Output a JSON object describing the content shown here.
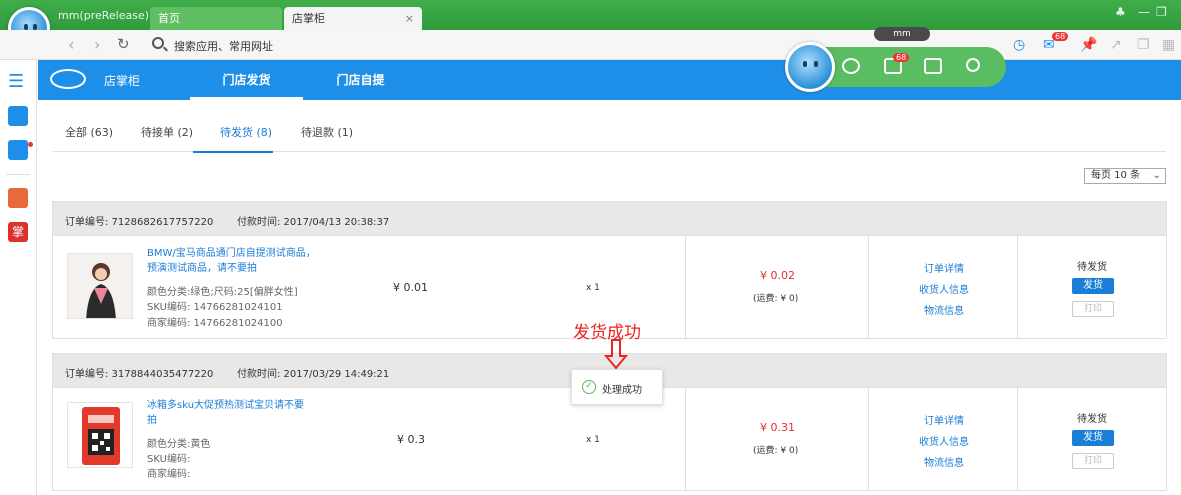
{
  "browser": {
    "app_name": "mm(preRelease)",
    "tabs": [
      {
        "label": "首页"
      },
      {
        "label": "店掌柜"
      }
    ],
    "tab_close": "×",
    "search_placeholder": "搜索应用、常用网址",
    "mail_badge": "68",
    "floatbar_badge": "68",
    "mm_label": "mm"
  },
  "app": {
    "logo_text": "店掌柜",
    "nav": [
      {
        "label": "门店发货"
      },
      {
        "label": "门店自提"
      }
    ]
  },
  "filter_tabs": [
    {
      "label": "全部 (63)"
    },
    {
      "label": "待接单 (2)"
    },
    {
      "label": "待发货 (8)"
    },
    {
      "label": "待退款 (1)"
    }
  ],
  "page_size": "每页 10 条",
  "orders": [
    {
      "order_no": "订单编号: 7128682617757220",
      "pay_time": "付款时间: 2017/04/13 20:38:37",
      "product_name": "BMW/宝马商品通门店自提测试商品，预演测试商品，请不要拍",
      "spec": "颜色分类:绿色;尺码:25[偏胖女性]",
      "sku": "SKU编码: 14766281024101",
      "merchant_code": "商家编码: 14766281024100",
      "price": "¥ 0.01",
      "qty": "x 1",
      "total": "¥ 0.02",
      "shipping": "(运费: ¥ 0)",
      "links": [
        "订单详情",
        "收货人信息",
        "物流信息"
      ],
      "status": "待发货",
      "ship_label": "发货",
      "print_label": "打印"
    },
    {
      "order_no": "订单编号: 3178844035477220",
      "pay_time": "付款时间: 2017/03/29 14:49:21",
      "product_name": "冰箱多sku大促预热测试宝贝请不要拍",
      "spec": "颜色分类:黄色",
      "sku": "SKU编码:",
      "merchant_code": "商家编码:",
      "price": "¥ 0.3",
      "qty": "x 1",
      "total": "¥ 0.31",
      "shipping": "(运费: ¥ 0)",
      "links": [
        "订单详情",
        "收货人信息",
        "物流信息"
      ],
      "status": "待发货",
      "ship_label": "发货",
      "print_label": "打印"
    }
  ],
  "annotation": "发货成功",
  "toast": {
    "text": "处理成功"
  },
  "colors": {
    "accent": "#1e8fe8",
    "titlebar": "#3fae4a",
    "price_red": "#d33"
  }
}
